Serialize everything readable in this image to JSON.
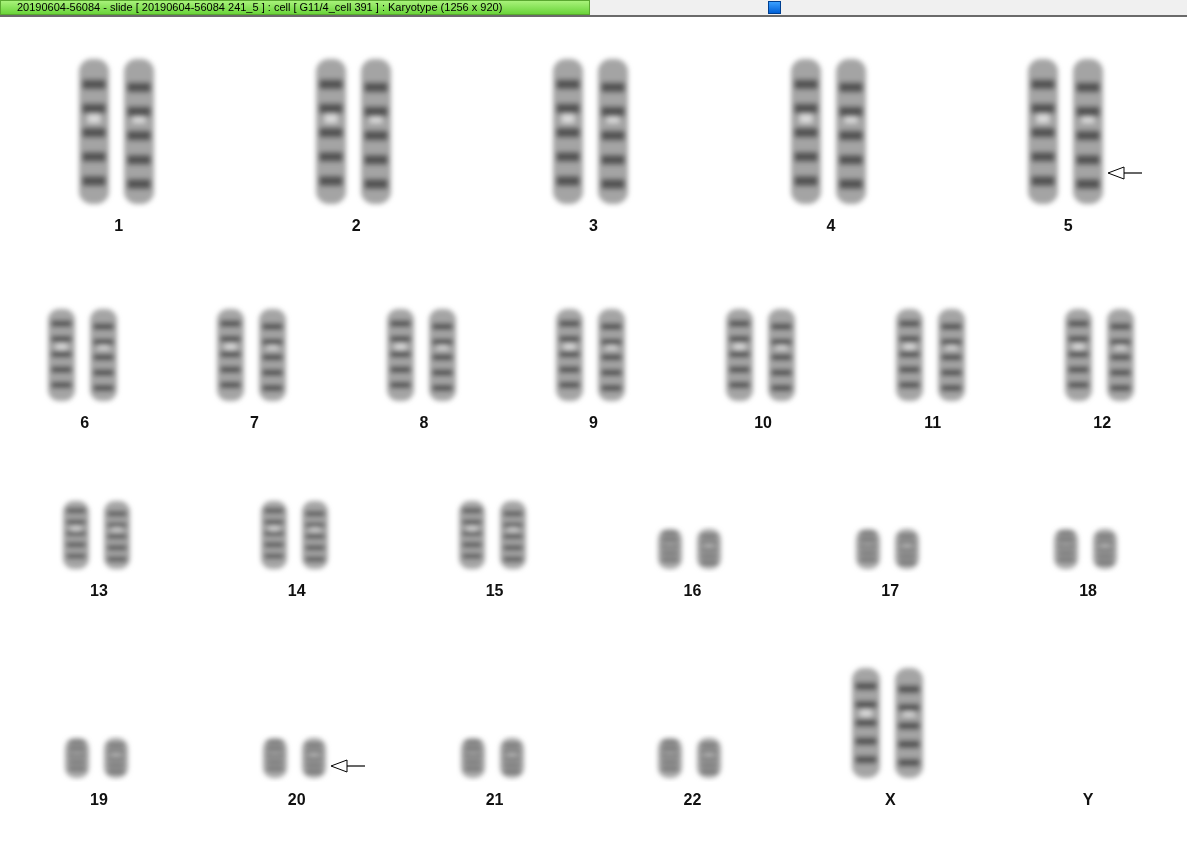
{
  "window": {
    "title": "20190604-56084 - slide [ 20190604-56084 241_5 ] : cell [ G11/4_cell 391 ] : Karyotype  (1256 x 920)"
  },
  "rows": [
    {
      "items": [
        {
          "label": "1",
          "kind": "large",
          "arrow": false
        },
        {
          "label": "2",
          "kind": "large",
          "arrow": false
        },
        {
          "label": "3",
          "kind": "large",
          "arrow": false
        },
        {
          "label": "4",
          "kind": "large",
          "arrow": false
        },
        {
          "label": "5",
          "kind": "large",
          "arrow": true
        }
      ]
    },
    {
      "items": [
        {
          "label": "6",
          "kind": "medium",
          "arrow": false
        },
        {
          "label": "7",
          "kind": "medium",
          "arrow": false
        },
        {
          "label": "8",
          "kind": "medium",
          "arrow": false
        },
        {
          "label": "9",
          "kind": "medium",
          "arrow": false
        },
        {
          "label": "10",
          "kind": "medium",
          "arrow": false
        },
        {
          "label": "11",
          "kind": "medium",
          "arrow": false
        },
        {
          "label": "12",
          "kind": "medium",
          "arrow": false
        }
      ]
    },
    {
      "items": [
        {
          "label": "13",
          "kind": "small",
          "arrow": false
        },
        {
          "label": "14",
          "kind": "small",
          "arrow": false
        },
        {
          "label": "15",
          "kind": "small",
          "arrow": false
        },
        {
          "label": "16",
          "kind": "tiny",
          "arrow": false
        },
        {
          "label": "17",
          "kind": "tiny",
          "arrow": false
        },
        {
          "label": "18",
          "kind": "tiny",
          "arrow": false
        }
      ]
    },
    {
      "items": [
        {
          "label": "19",
          "kind": "tiny",
          "arrow": false
        },
        {
          "label": "20",
          "kind": "tiny",
          "arrow": true
        },
        {
          "label": "21",
          "kind": "tiny",
          "arrow": false
        },
        {
          "label": "22",
          "kind": "tiny",
          "arrow": false
        },
        {
          "label": "X",
          "kind": "long",
          "arrow": false
        },
        {
          "label": "Y",
          "kind": "empty",
          "arrow": false
        }
      ]
    }
  ]
}
